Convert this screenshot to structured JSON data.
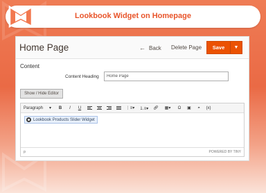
{
  "banner": {
    "title": "Lookbook Widget on Homepage"
  },
  "header": {
    "page_title": "Home Page",
    "back_label": "Back",
    "delete_label": "Delete Page",
    "save_label": "Save"
  },
  "content": {
    "section_title": "Content",
    "heading_label": "Content Heading",
    "heading_value": "Home Page",
    "toggle_editor_label": "Show / Hide Editor"
  },
  "editor": {
    "format_select": "Paragraph",
    "toolbar_items": [
      "bold-icon",
      "italic-icon",
      "underline-icon",
      "align-left-icon",
      "align-center-icon",
      "align-right-icon",
      "align-justify-icon",
      "bullet-list-icon",
      "numbered-list-icon",
      "link-icon",
      "table-icon",
      "special-char-icon",
      "image-icon",
      "widget-insert-icon",
      "variable-icon"
    ],
    "toolbar_glyphs": {
      "bold": "B",
      "italic": "I",
      "underline": "U",
      "special_char": "Ω",
      "variable": "(x)"
    },
    "widget_chip": "Lookbook Products Slider Widget",
    "status_path": "p",
    "powered_by": "POWERED BY TINY"
  },
  "colors": {
    "accent": "#eb5202",
    "banner_text": "#e8542a",
    "background": "#ea6a45"
  }
}
